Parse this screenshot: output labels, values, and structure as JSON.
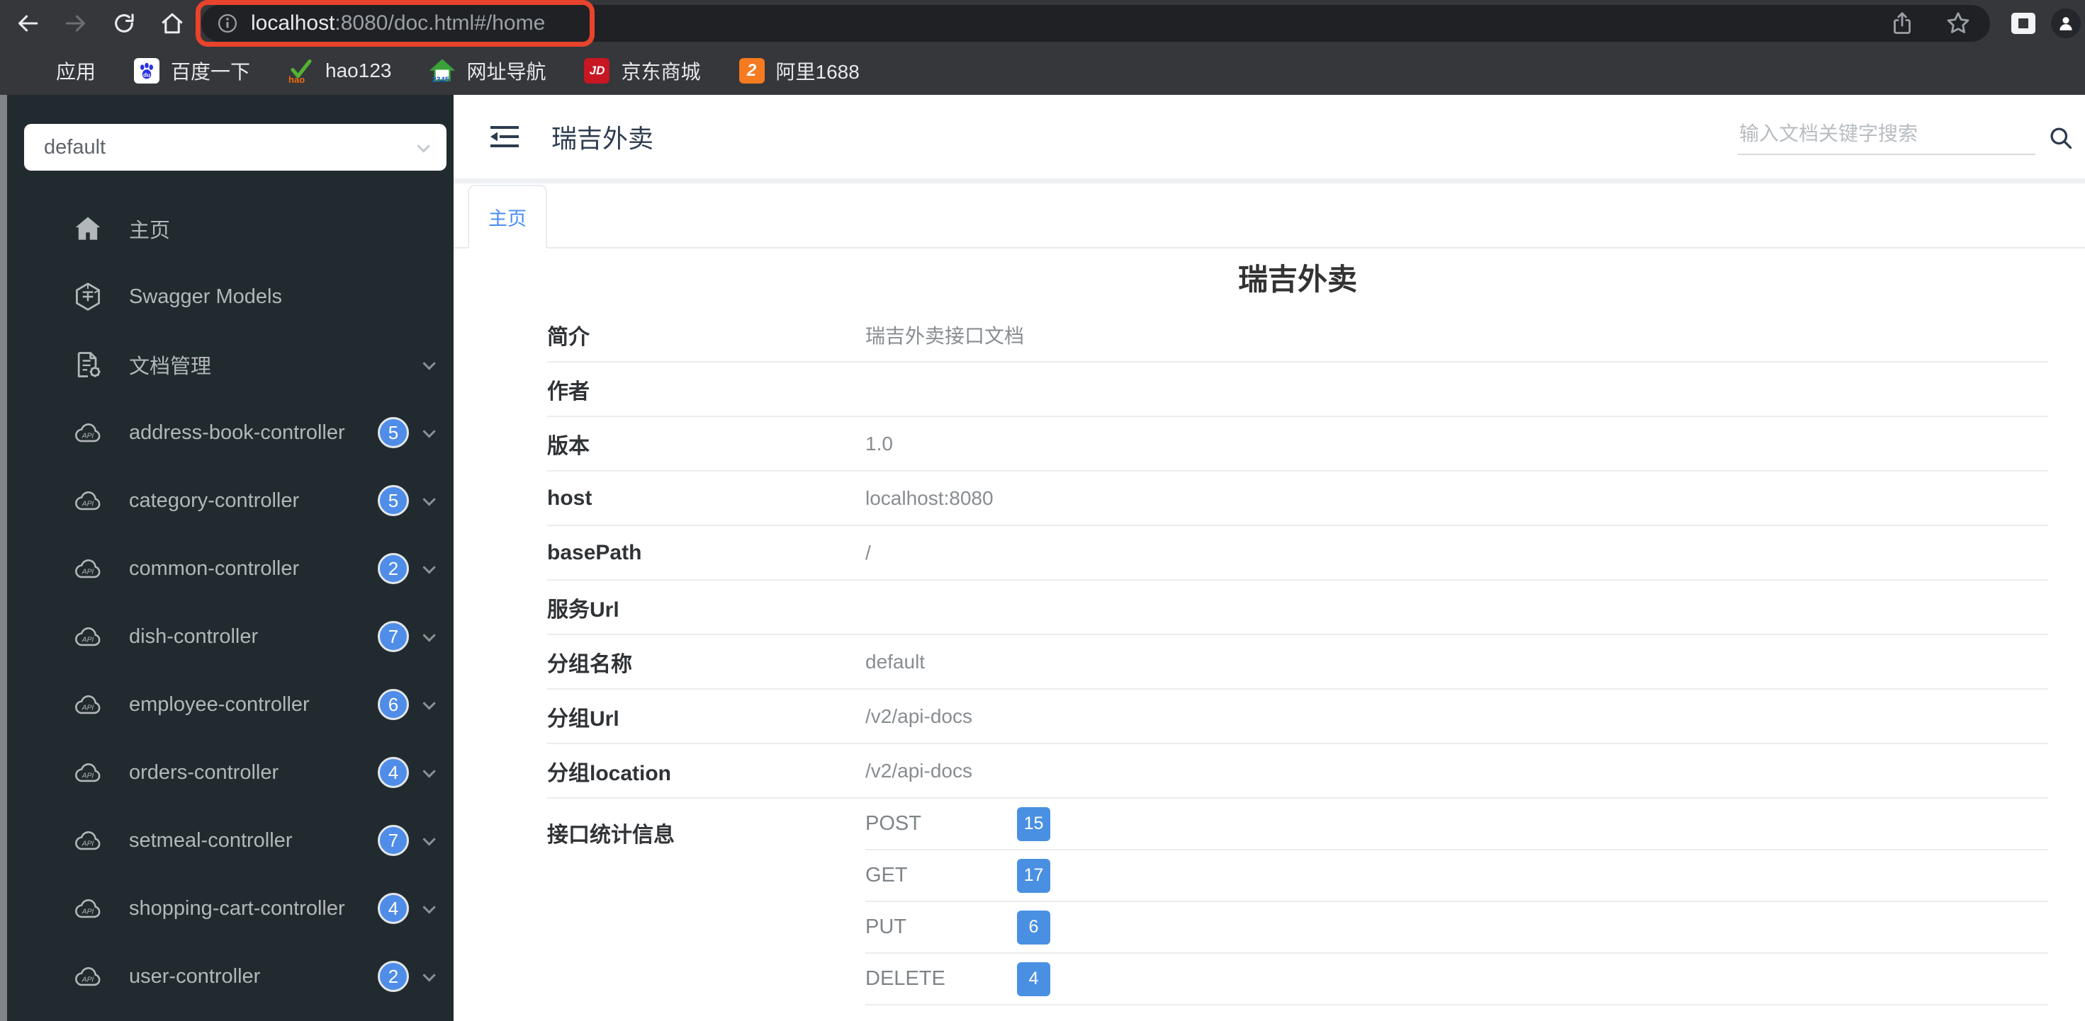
{
  "browser": {
    "url": {
      "host": "localhost",
      "path": ":8080/doc.html#/home"
    },
    "bookmarks": [
      {
        "label": "应用"
      },
      {
        "label": "百度一下",
        "icon_text": "du"
      },
      {
        "label": "hao123",
        "icon_text": "hao"
      },
      {
        "label": "网址导航",
        "icon_text": "2345"
      },
      {
        "label": "京东商城",
        "icon_text": "JD"
      },
      {
        "label": "阿里1688",
        "icon_text": "2"
      }
    ]
  },
  "sidebar": {
    "group_select_value": "default",
    "nav": {
      "home_label": "主页",
      "swagger_label": "Swagger Models",
      "docs_label": "文档管理"
    },
    "controllers": [
      {
        "name": "address-book-controller",
        "count": "5"
      },
      {
        "name": "category-controller",
        "count": "5"
      },
      {
        "name": "common-controller",
        "count": "2"
      },
      {
        "name": "dish-controller",
        "count": "7"
      },
      {
        "name": "employee-controller",
        "count": "6"
      },
      {
        "name": "orders-controller",
        "count": "4"
      },
      {
        "name": "setmeal-controller",
        "count": "7"
      },
      {
        "name": "shopping-cart-controller",
        "count": "4"
      },
      {
        "name": "user-controller",
        "count": "2"
      }
    ]
  },
  "header": {
    "brand": "瑞吉外卖",
    "search_placeholder": "输入文档关键字搜索"
  },
  "tabs": [
    {
      "label": "主页"
    }
  ],
  "home": {
    "title": "瑞吉外卖",
    "rows": [
      {
        "label": "简介",
        "value": "瑞吉外卖接口文档"
      },
      {
        "label": "作者",
        "value": ""
      },
      {
        "label": "版本",
        "value": "1.0"
      },
      {
        "label": "host",
        "value": "localhost:8080"
      },
      {
        "label": "basePath",
        "value": "/"
      },
      {
        "label": "服务Url",
        "value": ""
      },
      {
        "label": "分组名称",
        "value": "default"
      },
      {
        "label": "分组Url",
        "value": "/v2/api-docs"
      },
      {
        "label": "分组location",
        "value": "/v2/api-docs"
      }
    ],
    "stats": {
      "label": "接口统计信息",
      "methods": [
        {
          "name": "POST",
          "count": "15"
        },
        {
          "name": "GET",
          "count": "17"
        },
        {
          "name": "PUT",
          "count": "6"
        },
        {
          "name": "DELETE",
          "count": "4"
        }
      ]
    }
  },
  "colors": {
    "accent_blue": "#4a8cf7",
    "method_badge": "#4a90e2",
    "annotation_red": "#e8432c",
    "sidebar_bg": "#212a2f",
    "chrome_bg": "#35373b"
  }
}
